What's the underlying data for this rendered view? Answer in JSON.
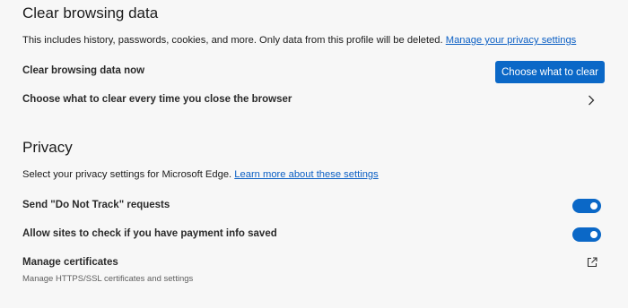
{
  "clear_section": {
    "title": "Clear browsing data",
    "description": "This includes history, passwords, cookies, and more. Only data from this profile will be deleted.",
    "manage_link": "Manage your privacy settings",
    "clear_now_label": "Clear browsing data now",
    "choose_button": "Choose what to clear",
    "on_close_label": "Choose what to clear every time you close the browser"
  },
  "privacy_section": {
    "title": "Privacy",
    "description": "Select your privacy settings for Microsoft Edge.",
    "learn_link": "Learn more about these settings",
    "do_not_track": {
      "label": "Send \"Do Not Track\" requests",
      "enabled": true
    },
    "payment_info": {
      "label": "Allow sites to check if you have payment info saved",
      "enabled": true
    },
    "certificates": {
      "label": "Manage certificates",
      "sublabel": "Manage HTTPS/SSL certificates and settings"
    }
  },
  "colors": {
    "accent": "#0b68c7",
    "link": "#0b5fc4",
    "background": "#f7f7f7"
  },
  "icons": {
    "chevron": "chevron-right-icon",
    "external": "external-link-icon"
  }
}
